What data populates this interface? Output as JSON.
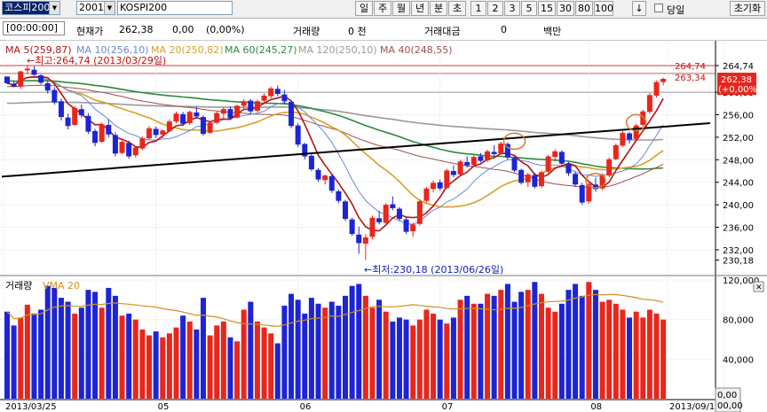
{
  "toolbar": {
    "market_combo": "코스피200",
    "code_combo": "2001",
    "name_field": "KOSPI200",
    "periods": [
      "일",
      "주",
      "월",
      "년",
      "분",
      "초"
    ],
    "intervals": [
      "1",
      "2",
      "3",
      "5",
      "15",
      "30",
      "80",
      "100"
    ],
    "down_arrow": "↓",
    "today_label": "당일",
    "reset_label": "초기화"
  },
  "info": {
    "time": "[00:00:00]",
    "price_label": "현재가",
    "price": "262,38",
    "change": "0,00",
    "change_pct": "(0,00%)",
    "volume_label": "거래량",
    "volume": "0 천",
    "amount_label": "거래대금",
    "amount": "0",
    "amount_unit": "백만"
  },
  "legend": {
    "ma5": "MA 5(259,87)",
    "ma10": "MA 10(256,10)",
    "ma20": "MA 20(250,82)",
    "ma60": "MA 60(245,27)",
    "ma120": "MA 120(250,10)",
    "ma40": "MA 40(248,55)"
  },
  "colors": {
    "up": "#e8261b",
    "down": "#1c24d6",
    "ma5": "#b01616",
    "ma10": "#6a86d8",
    "ma20": "#d8a028",
    "ma60": "#2e8a3c",
    "ma120": "#9a9a9a",
    "ma40": "#a05050",
    "vma": "#d09020"
  },
  "annotations": {
    "high": "←최고:264,74 (2013/03/29일)",
    "low": "←최저:230,18 (2013/06/26일)"
  },
  "price_axis": {
    "ticks": [
      "264,74",
      "260,00",
      "256,00",
      "252,00",
      "248,00",
      "244,00",
      "240,00",
      "236,00",
      "232,00",
      "230,18"
    ],
    "badge_top": "264,74",
    "badge_mid": "263,34",
    "current": "262,38",
    "current_pct": "(+0,00%)"
  },
  "volume_panel": {
    "label": "거래량",
    "vma_label": "VMA 20",
    "ticks": [
      "120,000",
      "80,000",
      "40,000"
    ]
  },
  "x_axis": {
    "labels": [
      "2013/03/25",
      "05",
      "06",
      "07",
      "08",
      "09",
      "2013/09/1"
    ]
  },
  "corner": {
    "top": "0,00",
    "bottom": "00,00"
  },
  "chart_data": {
    "type": "candlestick",
    "y_unit": "index",
    "ylim": [
      229,
      266
    ],
    "volume_ylim": [
      0,
      120000
    ],
    "first_date": "2013/03/25",
    "last_label": "2013/09/1",
    "candles": [
      [
        262.8,
        262.5,
        261.5,
        261.6,
        88000
      ],
      [
        261.5,
        261.9,
        260.9,
        261.0,
        74000
      ],
      [
        261.0,
        263.8,
        260.6,
        263.7,
        82000
      ],
      [
        263.9,
        264.7,
        263.2,
        264.2,
        95000
      ],
      [
        264.0,
        264.6,
        262.9,
        263.1,
        86000
      ],
      [
        263.0,
        263.2,
        261.4,
        261.7,
        90000
      ],
      [
        261.6,
        262.0,
        259.8,
        260.3,
        114000
      ],
      [
        260.4,
        260.9,
        257.8,
        258.2,
        112000
      ],
      [
        258.4,
        258.9,
        255.0,
        255.6,
        102000
      ],
      [
        255.5,
        256.2,
        253.4,
        254.0,
        98000
      ],
      [
        254.2,
        257.6,
        254.0,
        257.2,
        86000
      ],
      [
        257.0,
        257.8,
        255.5,
        255.9,
        92000
      ],
      [
        255.8,
        256.3,
        252.6,
        253.0,
        110000
      ],
      [
        253.1,
        253.5,
        250.4,
        251.0,
        108000
      ],
      [
        251.2,
        254.6,
        251.0,
        254.3,
        92000
      ],
      [
        254.2,
        255.2,
        252.0,
        252.5,
        112000
      ],
      [
        252.4,
        252.9,
        248.6,
        249.1,
        104000
      ],
      [
        249.2,
        251.5,
        249.0,
        251.2,
        84000
      ],
      [
        251.0,
        251.4,
        248.2,
        248.6,
        86000
      ],
      [
        248.8,
        250.5,
        248.4,
        250.2,
        80000
      ],
      [
        250.0,
        252.1,
        249.7,
        251.8,
        70000
      ],
      [
        251.8,
        254.0,
        251.6,
        253.6,
        64000
      ],
      [
        253.5,
        253.9,
        251.9,
        252.4,
        68000
      ],
      [
        252.5,
        253.4,
        251.8,
        253.2,
        62000
      ],
      [
        253.1,
        255.2,
        252.9,
        254.8,
        66000
      ],
      [
        254.8,
        256.6,
        254.5,
        256.2,
        72000
      ],
      [
        256.1,
        256.5,
        254.0,
        254.4,
        84000
      ],
      [
        254.5,
        256.8,
        254.2,
        256.5,
        78000
      ],
      [
        256.4,
        257.4,
        255.3,
        255.7,
        70000
      ],
      [
        255.6,
        255.9,
        252.3,
        252.6,
        102000
      ],
      [
        252.8,
        254.8,
        252.6,
        254.6,
        64000
      ],
      [
        254.6,
        256.6,
        254.3,
        256.3,
        74000
      ],
      [
        256.2,
        257.3,
        255.2,
        257.0,
        78000
      ],
      [
        257.0,
        257.5,
        255.1,
        255.4,
        62000
      ],
      [
        255.5,
        257.8,
        255.3,
        257.6,
        58000
      ],
      [
        257.6,
        258.8,
        257.1,
        258.4,
        90000
      ],
      [
        258.5,
        258.8,
        256.2,
        256.6,
        98000
      ],
      [
        256.7,
        258.7,
        256.4,
        258.4,
        78000
      ],
      [
        258.5,
        259.8,
        257.9,
        259.4,
        72000
      ],
      [
        259.3,
        261.0,
        258.9,
        260.7,
        66000
      ],
      [
        260.6,
        261.2,
        259.3,
        259.7,
        56000
      ],
      [
        259.6,
        260.4,
        258.0,
        258.4,
        94000
      ],
      [
        258.3,
        258.6,
        253.6,
        254.0,
        106000
      ],
      [
        254.1,
        254.5,
        250.3,
        250.7,
        100000
      ],
      [
        250.8,
        251.0,
        248.1,
        248.6,
        86000
      ],
      [
        248.7,
        249.1,
        246.0,
        246.3,
        102000
      ],
      [
        246.2,
        246.5,
        244.1,
        244.5,
        96000
      ],
      [
        244.4,
        245.4,
        243.6,
        245.2,
        92000
      ],
      [
        245.1,
        245.5,
        242.1,
        242.5,
        98000
      ],
      [
        242.4,
        242.7,
        240.3,
        240.7,
        94000
      ],
      [
        240.6,
        240.9,
        237.1,
        237.5,
        104000
      ],
      [
        237.4,
        237.7,
        234.5,
        234.8,
        114000
      ],
      [
        234.7,
        236.1,
        231.3,
        233.2,
        116000
      ],
      [
        233.1,
        234.8,
        230.2,
        234.2,
        104000
      ],
      [
        234.3,
        238.1,
        233.9,
        237.7,
        92000
      ],
      [
        237.6,
        238.9,
        236.5,
        236.9,
        100000
      ],
      [
        236.8,
        240.3,
        236.6,
        240.0,
        88000
      ],
      [
        240.1,
        241.5,
        239.0,
        239.4,
        78000
      ],
      [
        239.3,
        239.6,
        237.1,
        237.5,
        82000
      ],
      [
        237.4,
        237.8,
        234.8,
        235.2,
        80000
      ],
      [
        235.3,
        236.8,
        234.3,
        236.5,
        74000
      ],
      [
        236.6,
        241.0,
        236.3,
        240.6,
        80000
      ],
      [
        240.7,
        243.2,
        240.4,
        242.9,
        90000
      ],
      [
        242.8,
        244.3,
        242.2,
        243.9,
        86000
      ],
      [
        244.0,
        244.5,
        242.5,
        242.9,
        80000
      ],
      [
        243.0,
        246.4,
        242.8,
        246.1,
        76000
      ],
      [
        246.0,
        247.0,
        244.9,
        245.3,
        82000
      ],
      [
        245.4,
        248.0,
        245.2,
        247.7,
        100000
      ],
      [
        247.6,
        248.6,
        246.6,
        247.0,
        104000
      ],
      [
        247.1,
        248.8,
        246.9,
        248.5,
        96000
      ],
      [
        248.6,
        249.2,
        247.5,
        247.8,
        96000
      ],
      [
        247.9,
        249.8,
        247.6,
        249.5,
        106000
      ],
      [
        249.4,
        250.6,
        248.7,
        249.0,
        104000
      ],
      [
        249.1,
        251.2,
        248.9,
        250.9,
        110000
      ],
      [
        250.8,
        251.1,
        248.0,
        248.4,
        116000
      ],
      [
        248.3,
        248.6,
        245.8,
        246.1,
        98000
      ],
      [
        246.2,
        246.4,
        243.6,
        243.9,
        108000
      ],
      [
        244.0,
        245.7,
        243.2,
        245.4,
        110000
      ],
      [
        245.3,
        245.7,
        242.9,
        243.2,
        118000
      ],
      [
        243.3,
        246.1,
        243.0,
        245.8,
        106000
      ],
      [
        245.9,
        248.9,
        245.6,
        248.6,
        92000
      ],
      [
        248.5,
        249.9,
        247.7,
        249.5,
        88000
      ],
      [
        249.4,
        249.7,
        246.9,
        247.3,
        96000
      ],
      [
        247.2,
        247.6,
        245.1,
        245.6,
        110000
      ],
      [
        245.5,
        245.9,
        243.2,
        243.6,
        116000
      ],
      [
        243.5,
        243.9,
        240.0,
        240.4,
        104000
      ],
      [
        240.6,
        244.1,
        240.2,
        243.7,
        118000
      ],
      [
        243.6,
        244.8,
        242.3,
        242.8,
        110000
      ],
      [
        242.9,
        245.6,
        242.6,
        245.2,
        98000
      ],
      [
        245.2,
        248.4,
        244.9,
        248.1,
        100000
      ],
      [
        248.1,
        250.9,
        247.9,
        250.6,
        96000
      ],
      [
        250.5,
        253.1,
        250.2,
        252.8,
        90000
      ],
      [
        252.7,
        253.0,
        250.9,
        251.6,
        82000
      ],
      [
        251.7,
        254.4,
        251.5,
        254.1,
        88000
      ],
      [
        254.2,
        256.9,
        253.9,
        256.6,
        82000
      ],
      [
        256.5,
        259.9,
        256.2,
        259.5,
        90000
      ],
      [
        259.4,
        262.1,
        259.1,
        261.8,
        86000
      ],
      [
        261.8,
        262.6,
        261.2,
        262.38,
        80000
      ]
    ],
    "moving_averages": [
      "MA 5",
      "MA 10",
      "MA 20",
      "MA 60",
      "MA 120",
      "MA 40"
    ],
    "volume_ma": "VMA 20"
  }
}
